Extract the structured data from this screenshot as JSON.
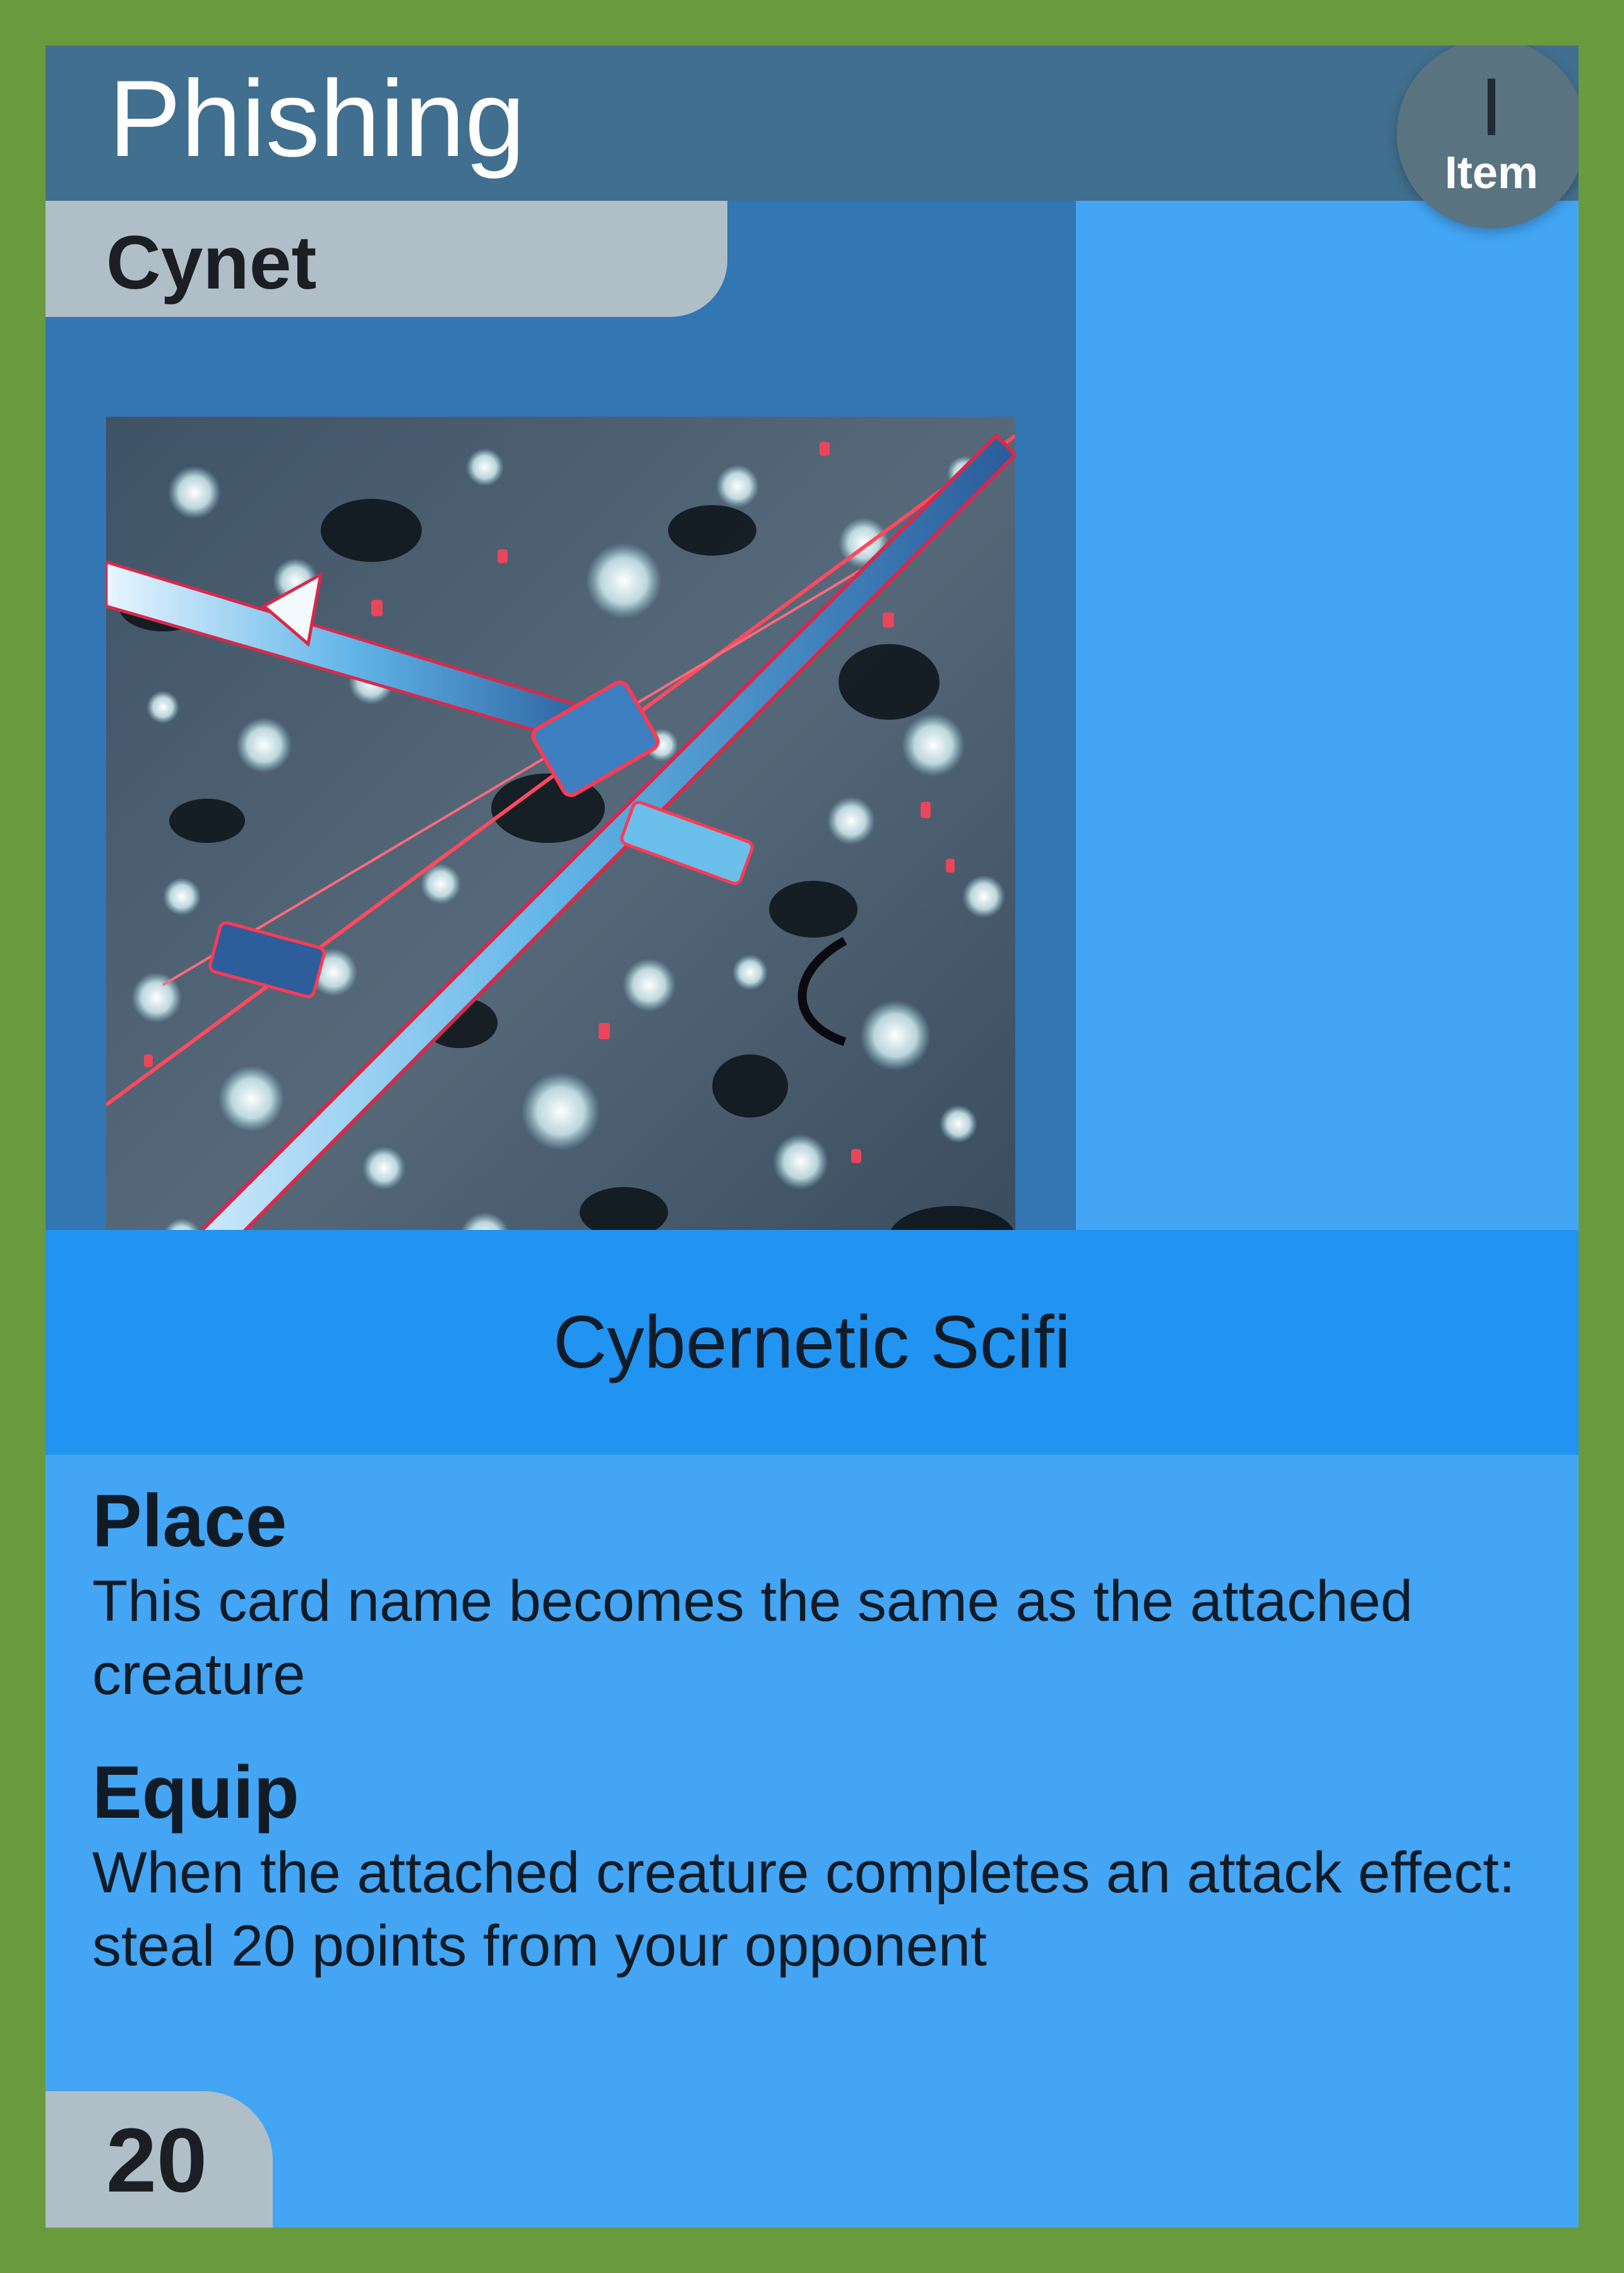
{
  "card": {
    "name": "Phishing",
    "subtitle": "Cynet",
    "type_glyph": "I",
    "type_label": "Item",
    "category": "Cybernetic Scifi",
    "cost": "20",
    "abilities": [
      {
        "name": "Place",
        "text": "This card name becomes the same as the attached creature"
      },
      {
        "name": "Equip",
        "text": "When the attached creature completes an attack effect: steal 20 points from your opponent"
      }
    ]
  },
  "art": {
    "description_icon": "cyber-crossbow-artwork"
  },
  "colors": {
    "border": "#6a9a3e",
    "header": "#416f8f",
    "body": "#43a5f4",
    "art_panel": "#3276b3",
    "category_band": "#2194f1",
    "tab": "#b0bec7"
  }
}
